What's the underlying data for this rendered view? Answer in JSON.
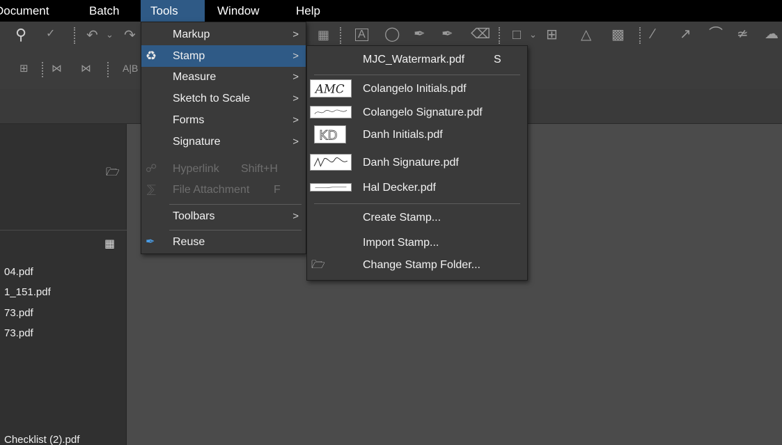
{
  "menubar": {
    "items": [
      "Document",
      "Batch",
      "Tools",
      "Window",
      "Help"
    ]
  },
  "tools_menu": {
    "items": [
      {
        "label": "Markup",
        "arrow": ">"
      },
      {
        "label": "Stamp",
        "arrow": ">"
      },
      {
        "label": "Measure",
        "arrow": ">"
      },
      {
        "label": "Sketch to Scale",
        "arrow": ">"
      },
      {
        "label": "Forms",
        "arrow": ">"
      },
      {
        "label": "Signature",
        "arrow": ">"
      },
      {
        "label": "Hyperlink",
        "shortcut": "Shift+H"
      },
      {
        "label": "File Attachment",
        "shortcut": "F"
      },
      {
        "label": "Toolbars",
        "arrow": ">"
      },
      {
        "label": "Reuse"
      }
    ]
  },
  "stamp_menu": {
    "watermark": {
      "label": "MJC_Watermark.pdf",
      "shortcut": "S"
    },
    "stamps": [
      {
        "label": "Colangelo Initials.pdf",
        "thumb_text": "AMC"
      },
      {
        "label": "Colangelo Signature.pdf"
      },
      {
        "label": "Danh Initials.pdf",
        "thumb_text": "KD"
      },
      {
        "label": "Danh Signature.pdf"
      },
      {
        "label": "Hal Decker.pdf"
      }
    ],
    "actions": [
      "Create Stamp...",
      "Import Stamp...",
      "Change Stamp Folder..."
    ]
  },
  "left_panel": {
    "files": [
      "04.pdf",
      "1_151.pdf",
      "73.pdf",
      "73.pdf",
      "Checklist (2).pdf"
    ]
  },
  "colors": {
    "highlight": "#2f5a86",
    "menu_bg": "#3a3a3a",
    "app_bg": "#4b4b4b"
  }
}
